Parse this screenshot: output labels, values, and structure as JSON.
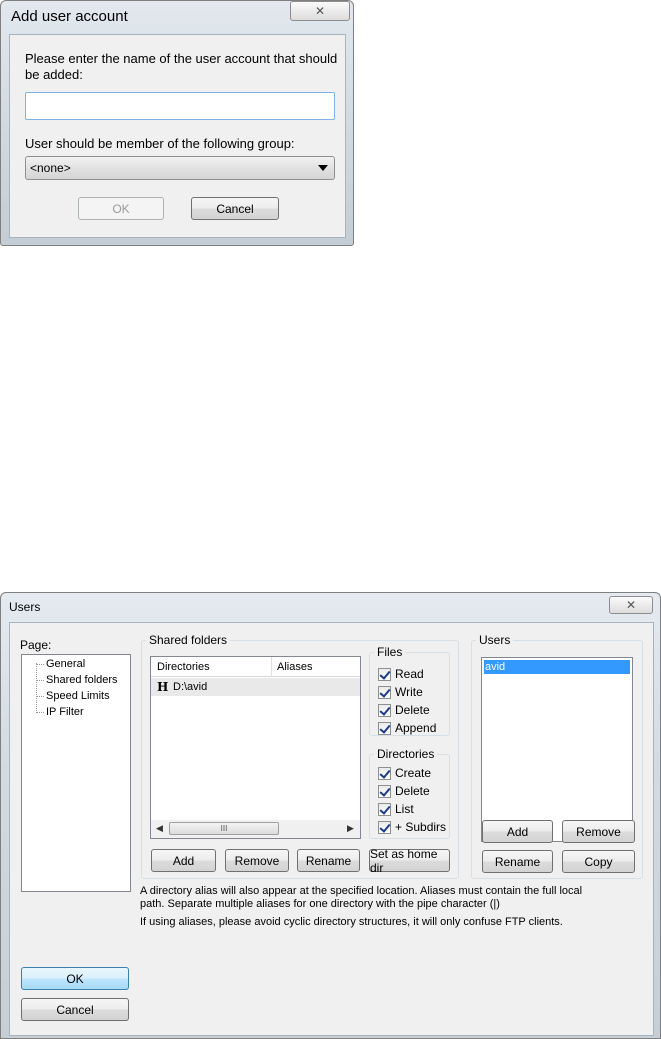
{
  "add_user_dialog": {
    "title": "Add user account",
    "close_glyph": "✕",
    "prompt": "Please enter the name of the user account that should be added:",
    "username_value": "",
    "group_label": "User should be member of the following group:",
    "group_selected": "<none>",
    "ok_label": "OK",
    "cancel_label": "Cancel"
  },
  "users_dialog": {
    "title": "Users",
    "close_glyph": "✕",
    "page_label": "Page:",
    "pages": [
      "General",
      "Shared folders",
      "Speed Limits",
      "IP Filter"
    ],
    "shared_folders": {
      "group_title": "Shared folders",
      "columns": [
        "Directories",
        "Aliases"
      ],
      "rows": [
        {
          "icon": "H",
          "directory": "D:\\avid",
          "alias": ""
        }
      ],
      "scroll_thumb_glyph": "III",
      "buttons": {
        "add": "Add",
        "remove": "Remove",
        "rename": "Rename",
        "set_home": "Set as home dir"
      }
    },
    "files": {
      "group_title": "Files",
      "options": [
        {
          "label": "Read",
          "checked": true
        },
        {
          "label": "Write",
          "checked": true
        },
        {
          "label": "Delete",
          "checked": true
        },
        {
          "label": "Append",
          "checked": true
        }
      ]
    },
    "directories": {
      "group_title": "Directories",
      "options": [
        {
          "label": "Create",
          "checked": true
        },
        {
          "label": "Delete",
          "checked": true
        },
        {
          "label": "List",
          "checked": true
        },
        {
          "label": "+ Subdirs",
          "checked": true
        }
      ]
    },
    "users": {
      "group_title": "Users",
      "items": [
        "avid"
      ],
      "buttons": {
        "add": "Add",
        "remove": "Remove",
        "rename": "Rename",
        "copy": "Copy"
      }
    },
    "notes": [
      "A directory alias will also appear at the specified location. Aliases must contain the full local path. Separate multiple aliases for one directory with the pipe character (|)",
      "If using aliases, please avoid cyclic directory structures, it will only confuse FTP clients."
    ],
    "ok_label": "OK",
    "cancel_label": "Cancel"
  }
}
